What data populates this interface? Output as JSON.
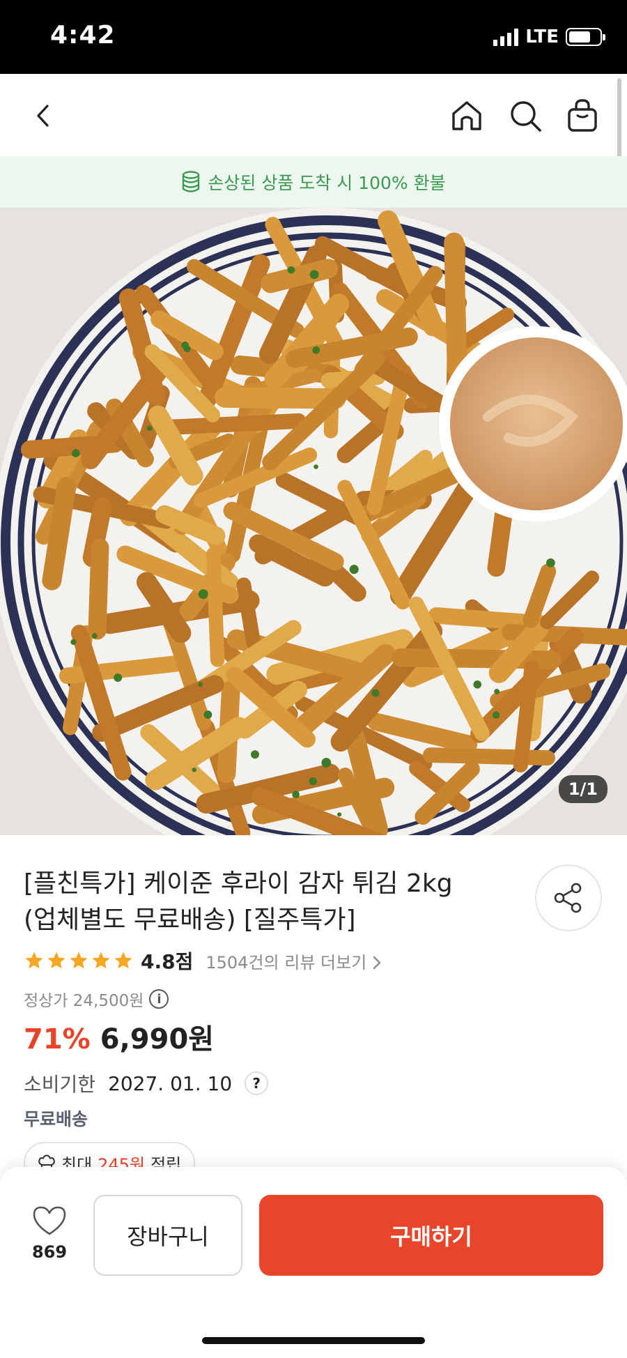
{
  "status_bar": {
    "time": "4:42",
    "network": "LTE"
  },
  "banner": {
    "text": "손상된 상품 도착 시 100% 환불"
  },
  "image": {
    "counter": "1/1",
    "description": "seasoned french fries with dipping sauce"
  },
  "product": {
    "title_line1": "[플친특가] 케이준 후라이 감자 튀김 2kg",
    "title_line2": "(업체별도 무료배송) [질주특가]",
    "rating": {
      "stars": 5,
      "score": "4.8점",
      "reviews": "1504건의 리뷰 더보기"
    },
    "original_price": "정상가 24,500원",
    "discount": "71%",
    "price": "6,990원",
    "expiry_label": "소비기한",
    "expiry_value": "2027. 01. 10",
    "help": "?",
    "shipping": "무료배송",
    "points": {
      "prefix": "최대",
      "amount": "245원",
      "suffix": "적립"
    }
  },
  "bottom_bar": {
    "like_count": "869",
    "cart_label": "장바구니",
    "buy_label": "구매하기"
  },
  "colors": {
    "accent": "#e8462a",
    "banner_green": "#3a9a52",
    "star": "#f5a623"
  }
}
